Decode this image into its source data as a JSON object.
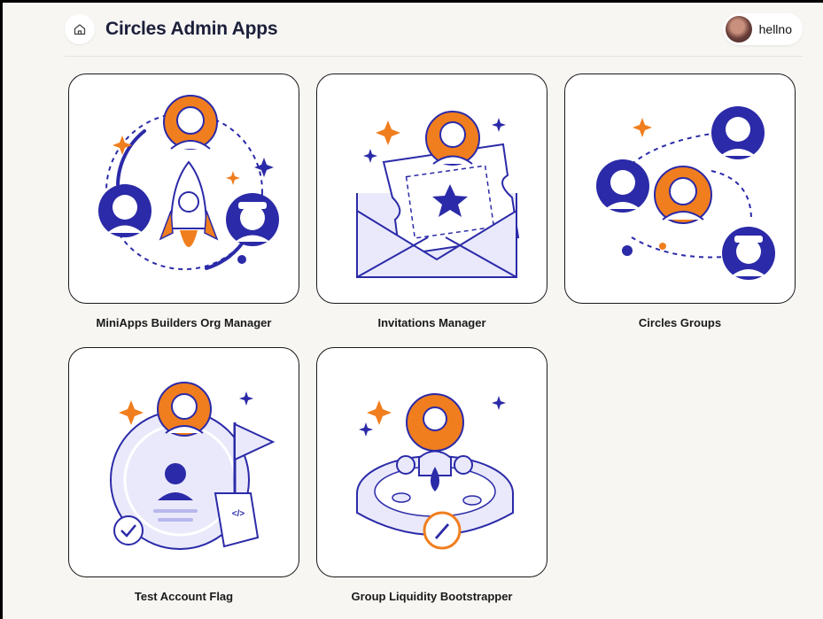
{
  "header": {
    "title": "Circles Admin Apps",
    "home_icon": "home-icon",
    "user": {
      "name": "hellno"
    }
  },
  "apps": [
    {
      "label": "MiniApps Builders Org Manager",
      "icon": "rocket-people-illustration"
    },
    {
      "label": "Invitations Manager",
      "icon": "envelope-ticket-illustration"
    },
    {
      "label": "Circles Groups",
      "icon": "connected-people-illustration"
    },
    {
      "label": "Test Account Flag",
      "icon": "test-account-illustration"
    },
    {
      "label": "Group Liquidity Bootstrapper",
      "icon": "liquidity-pool-illustration"
    }
  ],
  "colors": {
    "accent_orange": "#f07e1e",
    "accent_blue": "#2b2aa8",
    "light_blue": "#e9e9fb",
    "background": "#f7f6f3"
  }
}
